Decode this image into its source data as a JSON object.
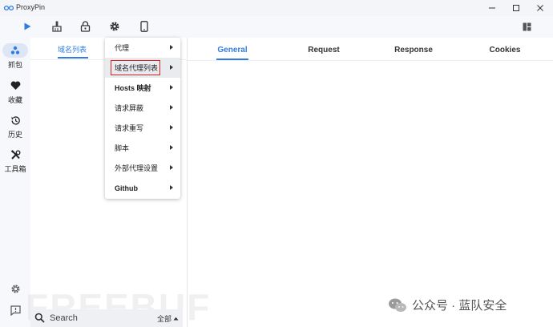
{
  "window": {
    "title": "ProxyPin",
    "controls": [
      "minimize",
      "maximize",
      "close"
    ]
  },
  "toolbar": {
    "icons": [
      "play-icon",
      "broom-icon",
      "lock-icon",
      "gear-icon",
      "phone-icon"
    ],
    "right_icon": "layout-icon",
    "accent": "#2f7de1"
  },
  "rail": {
    "items": [
      {
        "label": "抓包",
        "icon": "capture-icon",
        "active": true
      },
      {
        "label": "收藏",
        "icon": "heart-icon",
        "active": false
      },
      {
        "label": "历史",
        "icon": "history-icon",
        "active": false
      },
      {
        "label": "工具箱",
        "icon": "tools-icon",
        "active": false
      }
    ],
    "bottom_icons": [
      "settings-icon",
      "feedback-icon"
    ]
  },
  "domain_panel": {
    "tab_label": "域名列表"
  },
  "search": {
    "placeholder": "Search",
    "filter_value": "全部"
  },
  "details": {
    "tabs": [
      "General",
      "Request",
      "Response",
      "Cookies"
    ],
    "active_tab": "General"
  },
  "menu": {
    "items": [
      {
        "label": "代理"
      },
      {
        "label": "域名代理列表",
        "highlighted": true
      },
      {
        "label": "Hosts 映射"
      },
      {
        "label": "请求屏蔽"
      },
      {
        "label": "请求重写"
      },
      {
        "label": "脚本"
      },
      {
        "label": "外部代理设置"
      },
      {
        "label": "Github"
      }
    ]
  },
  "watermarks": {
    "site": "FREEBUF",
    "wechat": "公众号 · 蓝队安全"
  }
}
